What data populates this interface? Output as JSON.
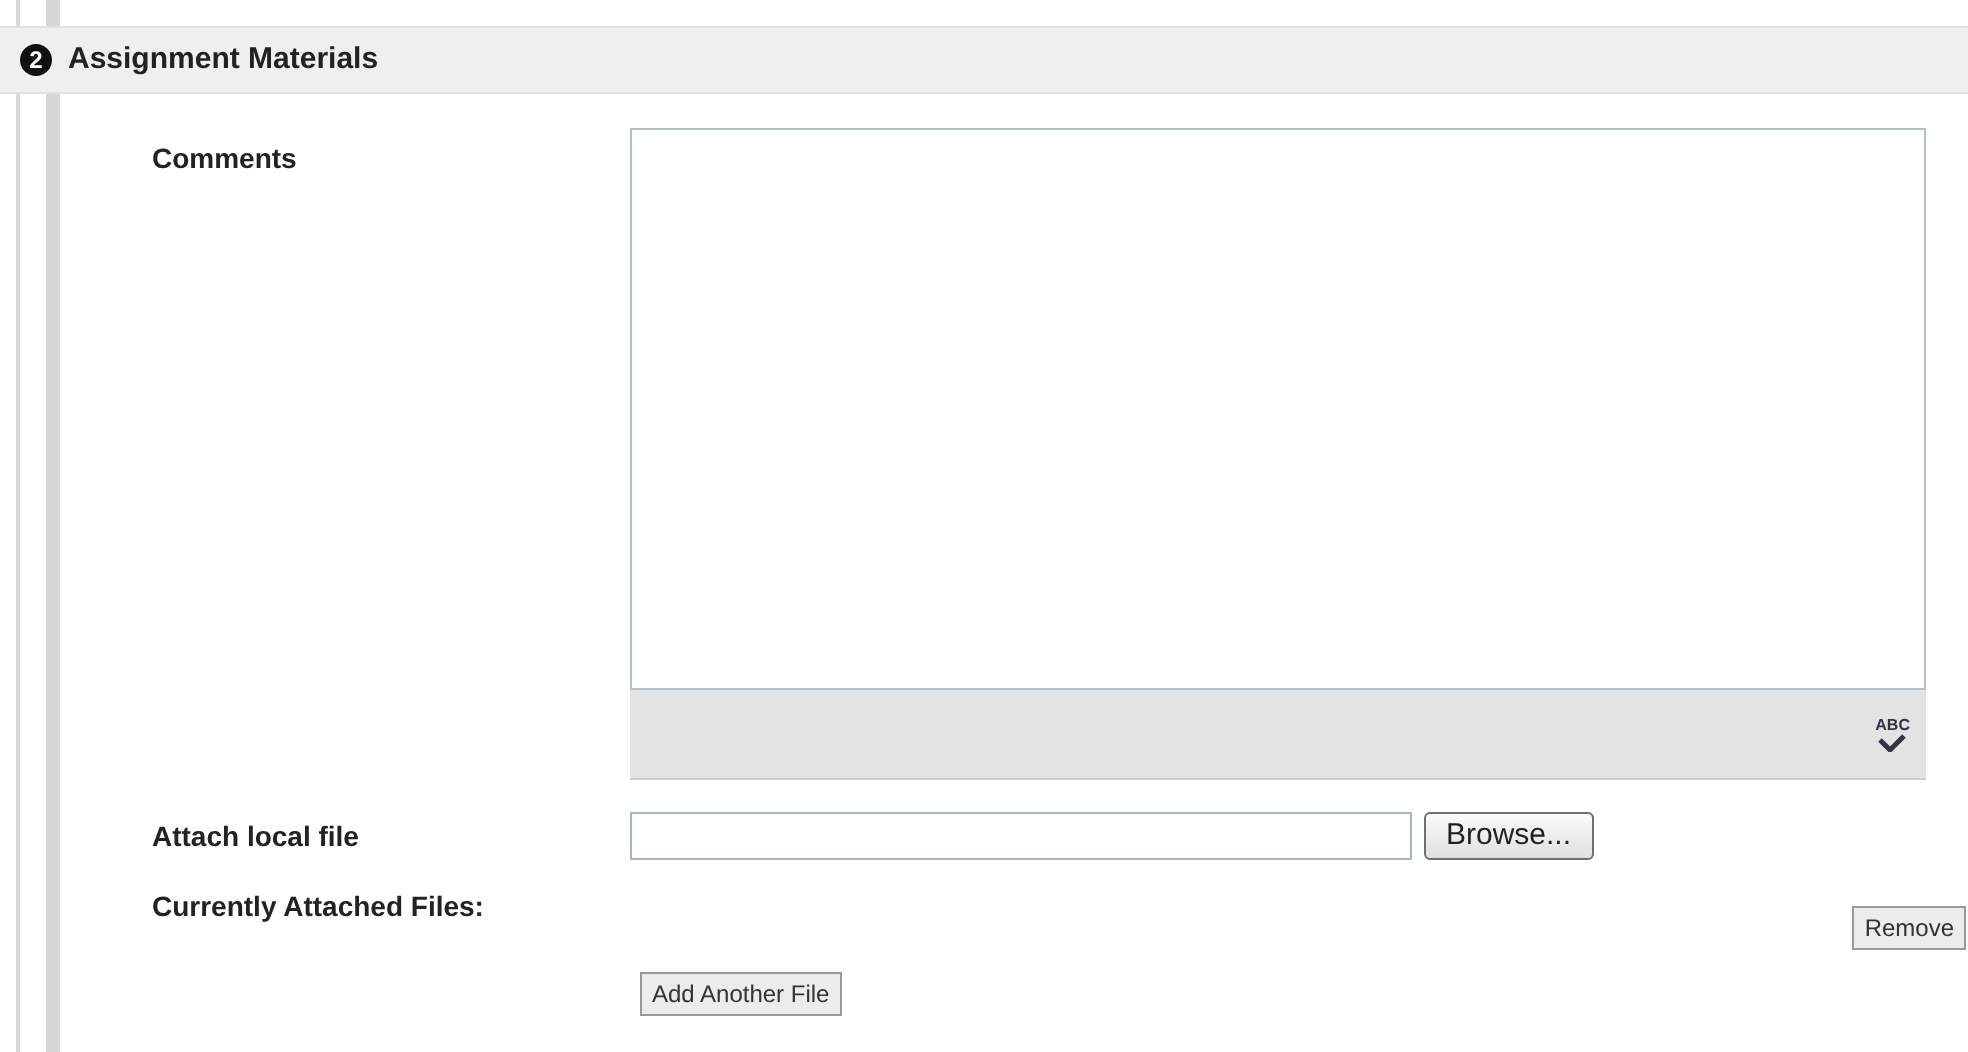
{
  "section": {
    "step": "2",
    "title": "Assignment Materials"
  },
  "comments": {
    "label": "Comments",
    "spellcheck_label": "ABC"
  },
  "attach": {
    "label": "Attach local file",
    "button": "Browse..."
  },
  "attached_files": {
    "label": "Currently Attached Files:",
    "button": "Remove"
  },
  "add_button": "Add Another File"
}
